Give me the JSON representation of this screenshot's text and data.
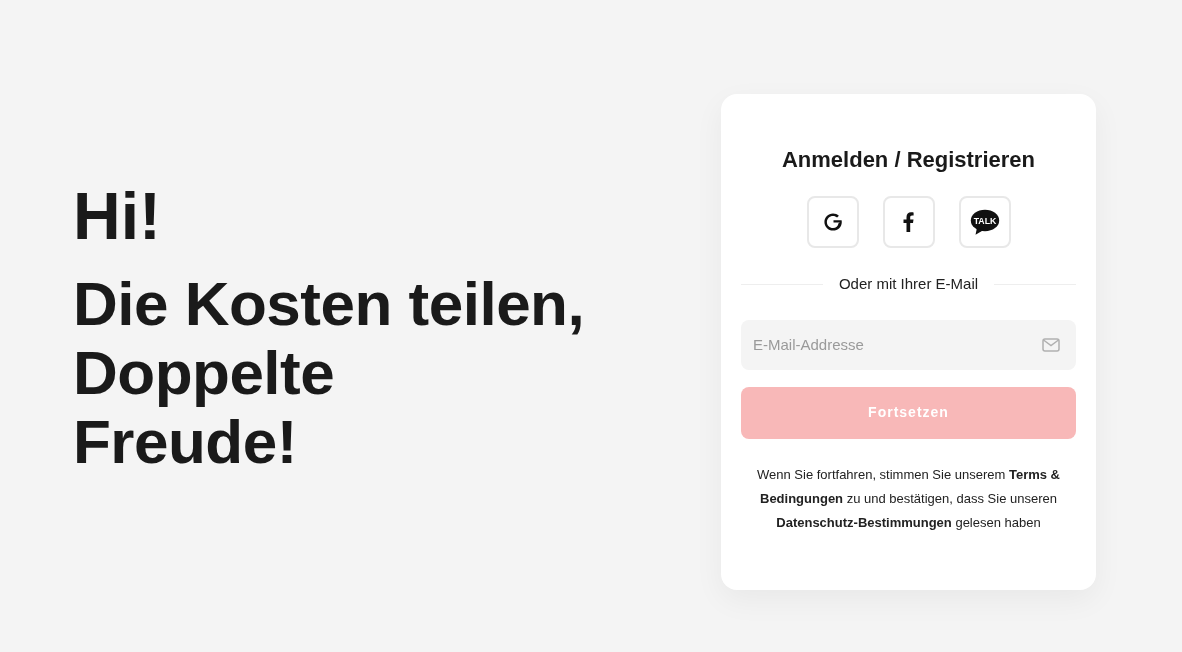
{
  "hero": {
    "greeting": "Hi!",
    "headline_lines": [
      "Die Kosten teilen,",
      "Doppelte",
      "Freude!"
    ]
  },
  "card": {
    "title": "Anmelden / Registrieren",
    "social_buttons": [
      {
        "kind": "google"
      },
      {
        "kind": "facebook"
      },
      {
        "kind": "chat",
        "badge": "TALK"
      }
    ],
    "divider_text": "Oder mit Ihrer E-Mail",
    "email_field": {
      "placeholder": "E-Mail-Addresse"
    },
    "continue_button": {
      "label": "Fortsetzen",
      "disabled": true
    },
    "legal_text": "Wenn Sie fortfahren, stimmen Sie unserem **Terms & Bedingungen** zu und bestätigen, dass Sie unseren **Datenschutz-Bestimmungen** gelesen haben"
  }
}
